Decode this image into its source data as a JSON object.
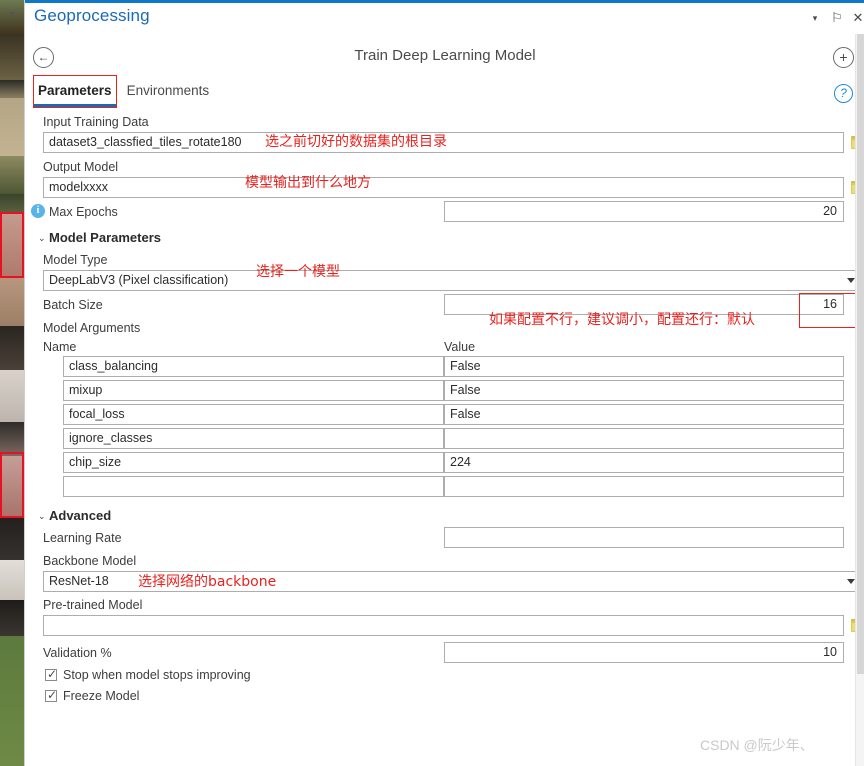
{
  "window": {
    "title": "Geoprocessing",
    "accent_color": "#0e77c8",
    "controls": {
      "menu": "▾",
      "pin": "⚐",
      "close": "✕"
    }
  },
  "header": {
    "back_icon": "←",
    "tool_title": "Train Deep Learning Model",
    "add_icon": "+",
    "help_icon": "?"
  },
  "tabs": [
    {
      "label": "Parameters",
      "active": true
    },
    {
      "label": "Environments",
      "active": false
    }
  ],
  "form": {
    "input_training_data": {
      "label": "Input Training Data",
      "value": "dataset3_classfied_tiles_rotate180",
      "browse_icon": "folder-icon"
    },
    "output_model": {
      "label": "Output Model",
      "value": "modelxxxx",
      "browse_icon": "folder-icon"
    },
    "max_epochs": {
      "label": "Max Epochs",
      "value": "20",
      "info_icon": "i"
    }
  },
  "model_parameters": {
    "section_label": "Model Parameters",
    "chevron": "⌄",
    "model_type": {
      "label": "Model Type",
      "value": "DeepLabV3 (Pixel classification)"
    },
    "batch_size": {
      "label": "Batch Size",
      "value": "16"
    },
    "model_arguments": {
      "label": "Model Arguments",
      "columns": [
        "Name",
        "Value"
      ],
      "rows": [
        {
          "name": "class_balancing",
          "value": "False"
        },
        {
          "name": "mixup",
          "value": "False"
        },
        {
          "name": "focal_loss",
          "value": "False"
        },
        {
          "name": "ignore_classes",
          "value": ""
        },
        {
          "name": "chip_size",
          "value": "224"
        },
        {
          "name": "",
          "value": ""
        }
      ]
    }
  },
  "advanced": {
    "section_label": "Advanced",
    "chevron": "⌄",
    "learning_rate": {
      "label": "Learning Rate",
      "value": ""
    },
    "backbone_model": {
      "label": "Backbone Model",
      "value": "ResNet-18"
    },
    "pretrained_model": {
      "label": "Pre-trained Model",
      "value": "",
      "browse_icon": "folder-icon"
    },
    "validation_pct": {
      "label": "Validation %",
      "value": "10"
    },
    "checkboxes": [
      {
        "label": "Stop when model stops improving",
        "checked": true
      },
      {
        "label": "Freeze Model",
        "checked": true
      }
    ]
  },
  "annotations": {
    "color": "#e8231f",
    "notes": [
      "选之前切好的数据集的根目录",
      "模型输出到什么地方",
      "选择一个模型",
      "如果配置不行，建议调小，配置还行：默认",
      "选择网络的backbone"
    ]
  },
  "watermark": {
    "text": "CSDN @阮少年、"
  }
}
